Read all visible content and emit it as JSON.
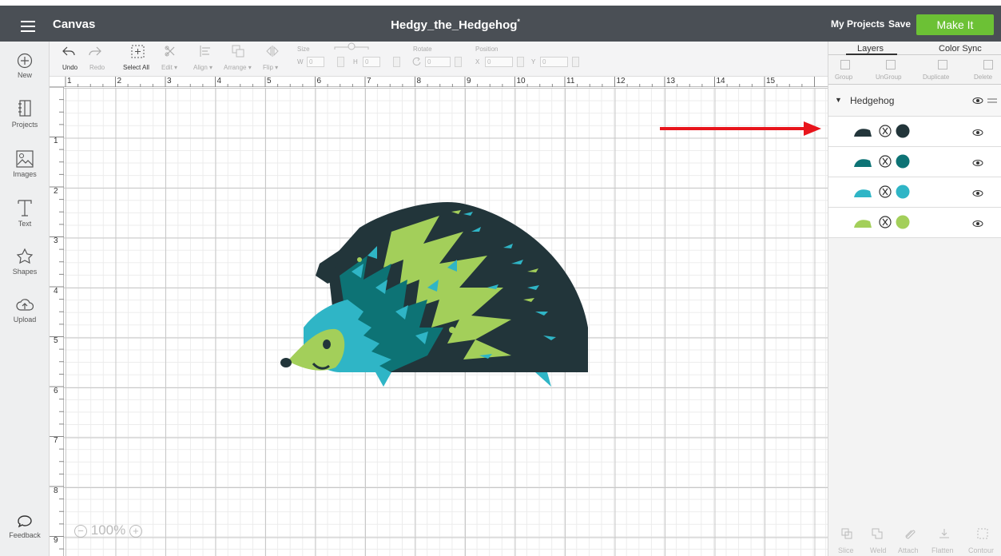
{
  "topbar": {
    "app_title": "Canvas",
    "project_title": "Hedgy_the_Hedgehog",
    "unsaved_marker": "*",
    "my_projects": "My Projects",
    "save": "Save",
    "make_it": "Make It",
    "make_it_color": "#6cc135"
  },
  "sidebar": {
    "items": [
      {
        "label": "New",
        "icon": "plus-circle-icon"
      },
      {
        "label": "Projects",
        "icon": "projects-icon"
      },
      {
        "label": "Images",
        "icon": "images-icon"
      },
      {
        "label": "Text",
        "icon": "text-icon"
      },
      {
        "label": "Shapes",
        "icon": "shapes-icon"
      },
      {
        "label": "Upload",
        "icon": "upload-icon"
      },
      {
        "label": "Feedback",
        "icon": "feedback-icon"
      }
    ]
  },
  "toolbar": {
    "undo": "Undo",
    "redo": "Redo",
    "select_all": "Select All",
    "edit": "Edit",
    "align": "Align",
    "arrange": "Arrange",
    "flip": "Flip",
    "size": "Size",
    "w": "W",
    "h": "H",
    "w_value": "0",
    "h_value": "0",
    "rotate": "Rotate",
    "rotate_value": "0",
    "position": "Position",
    "x": "X",
    "y": "Y",
    "x_value": "0",
    "y_value": "0"
  },
  "ruler": {
    "top": [
      "1",
      "2",
      "3",
      "4",
      "5",
      "6",
      "7",
      "8",
      "9",
      "10",
      "11",
      "12",
      "13",
      "14",
      "15"
    ],
    "left": [
      "1",
      "2",
      "3",
      "4",
      "5",
      "6",
      "7",
      "8",
      "9"
    ]
  },
  "zoom": "100%",
  "panel": {
    "tabs": [
      "Layers",
      "Color Sync"
    ],
    "tools": [
      "Group",
      "UnGroup",
      "Duplicate",
      "Delete"
    ],
    "group_name": "Hedgehog",
    "layers": [
      {
        "color": "#22353a"
      },
      {
        "color": "#0d7375"
      },
      {
        "color": "#2fb5c6"
      },
      {
        "color": "#a3cf5a"
      }
    ],
    "bottom_tools": [
      "Slice",
      "Weld",
      "Attach",
      "Flatten",
      "Contour"
    ]
  },
  "annotation_color": "#e8141b"
}
